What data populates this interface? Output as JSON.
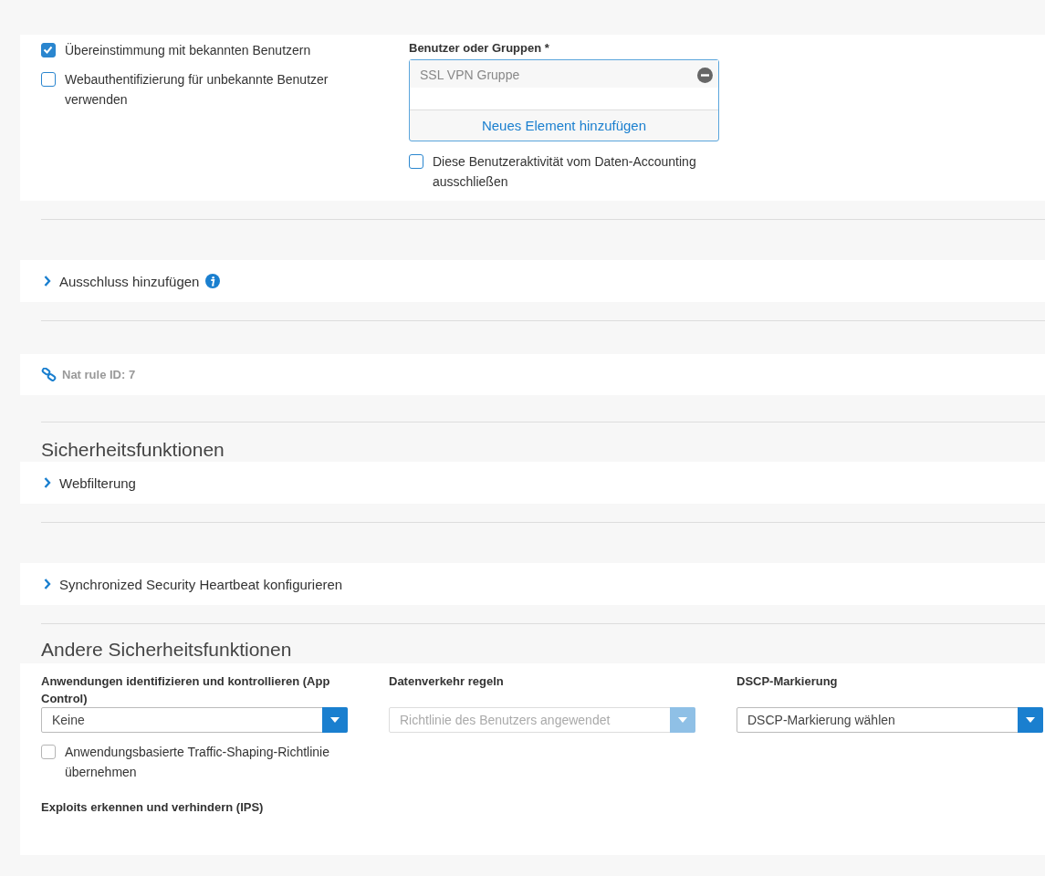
{
  "user_section": {
    "checkboxes": [
      {
        "label": "Übereinstimmung mit bekannten Benutzern",
        "checked": true,
        "disabled": false
      },
      {
        "label": "Webauthentifizierung für unbekannte Benutzer verwenden",
        "checked": false,
        "disabled": false
      }
    ],
    "users_field": {
      "label": "Benutzer oder Gruppen *",
      "items": [
        {
          "text": "SSL VPN Gruppe"
        }
      ],
      "add_label": "Neues Element hinzufügen"
    },
    "exclude_checkbox": {
      "label": "Diese Benutzeraktivität vom Daten-Accounting ausschließen",
      "checked": false,
      "disabled": false
    }
  },
  "exclusion": {
    "label": "Ausschluss hinzufügen",
    "expanded": false
  },
  "nat_rule": {
    "text": "Nat rule ID: 7"
  },
  "security": {
    "heading": "Sicherheitsfunktionen",
    "sections": [
      {
        "label": "Webfilterung",
        "expanded": false
      },
      {
        "label": "Synchronized Security Heartbeat konfigurieren",
        "expanded": false
      }
    ]
  },
  "other_security": {
    "heading": "Andere Sicherheitsfunktionen",
    "fields": [
      {
        "label": "Anwendungen identifizieren und kontrollieren (App Control)",
        "value": "Keine",
        "disabled": false
      },
      {
        "label": "Datenverkehr regeln",
        "value": "Richtlinie des Benutzers angewendet",
        "disabled": true
      },
      {
        "label": "DSCP-Markierung",
        "value": "DSCP-Markierung wählen",
        "disabled": false
      }
    ],
    "traffic_checkbox": {
      "label": "Anwendungsbasierte Traffic-Shaping-Richtlinie übernehmen",
      "checked": false,
      "disabled": true
    },
    "ips_label": "Exploits erkennen und verhindern (IPS)"
  }
}
